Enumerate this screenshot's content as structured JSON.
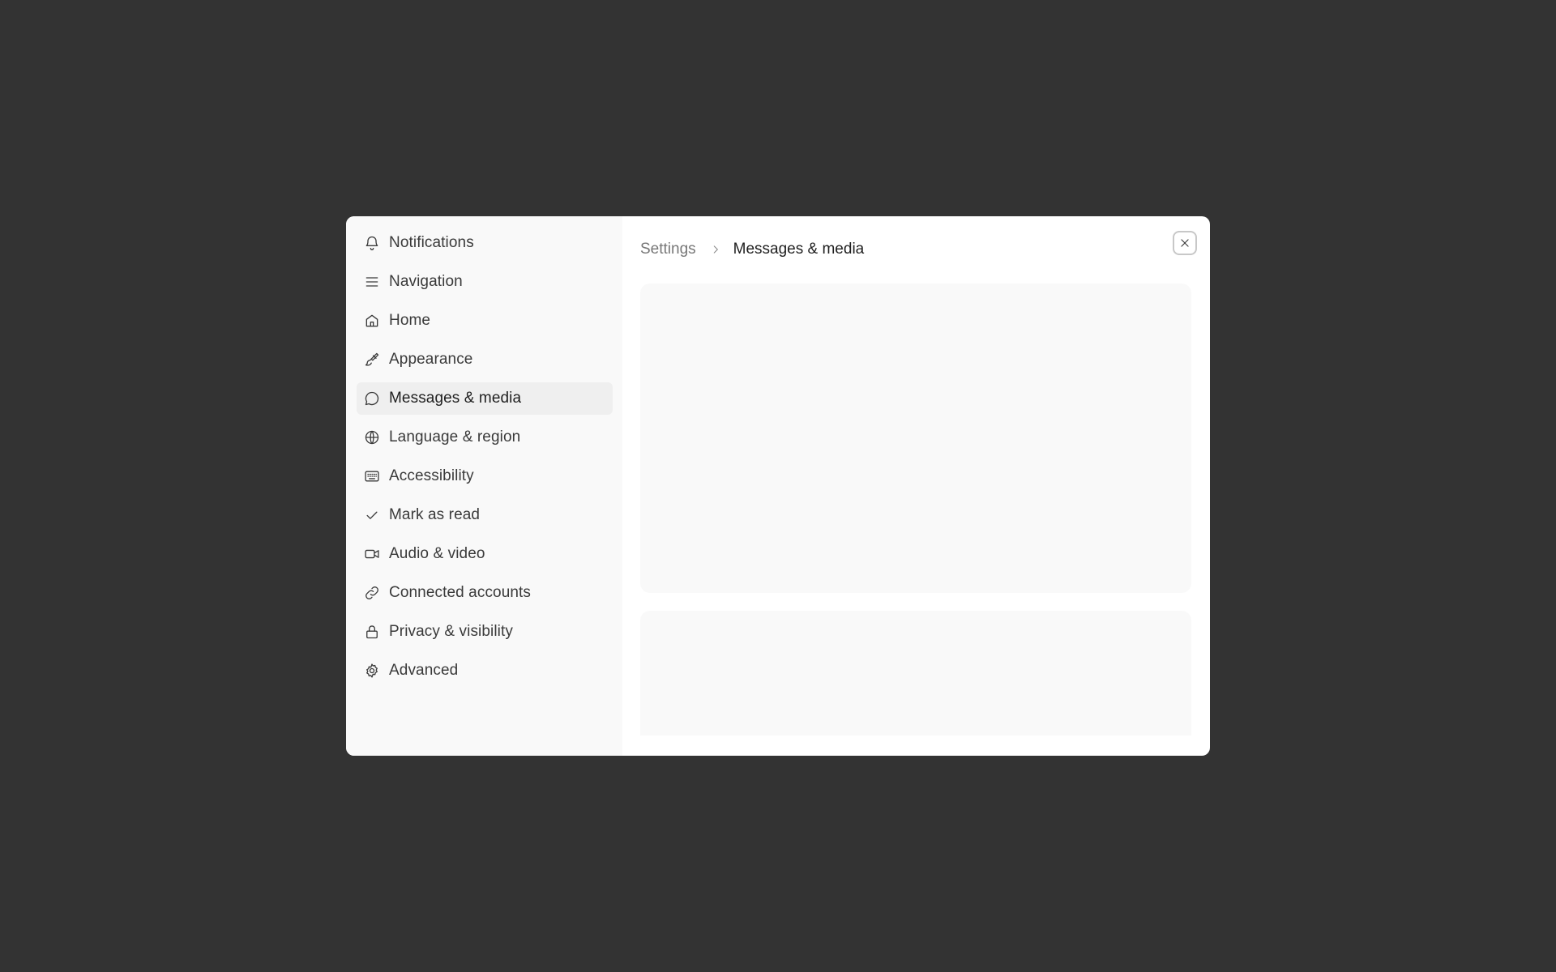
{
  "sidebar": {
    "items": [
      {
        "label": "Notifications",
        "icon": "bell-icon"
      },
      {
        "label": "Navigation",
        "icon": "menu-icon"
      },
      {
        "label": "Home",
        "icon": "home-icon"
      },
      {
        "label": "Appearance",
        "icon": "paintbrush-icon"
      },
      {
        "label": "Messages & media",
        "icon": "chat-bubble-icon",
        "active": true
      },
      {
        "label": "Language & region",
        "icon": "globe-icon"
      },
      {
        "label": "Accessibility",
        "icon": "keyboard-icon"
      },
      {
        "label": "Mark as read",
        "icon": "check-icon"
      },
      {
        "label": "Audio & video",
        "icon": "video-camera-icon"
      },
      {
        "label": "Connected accounts",
        "icon": "link-icon"
      },
      {
        "label": "Privacy & visibility",
        "icon": "lock-icon"
      },
      {
        "label": "Advanced",
        "icon": "gear-icon"
      }
    ]
  },
  "breadcrumb": {
    "root": "Settings",
    "current": "Messages & media"
  },
  "colors": {
    "backdrop": "#333333",
    "modal": "#ffffff",
    "sidebar": "#f9f9f9",
    "active_item": "#efefef",
    "panel": "#f9f9f9"
  }
}
